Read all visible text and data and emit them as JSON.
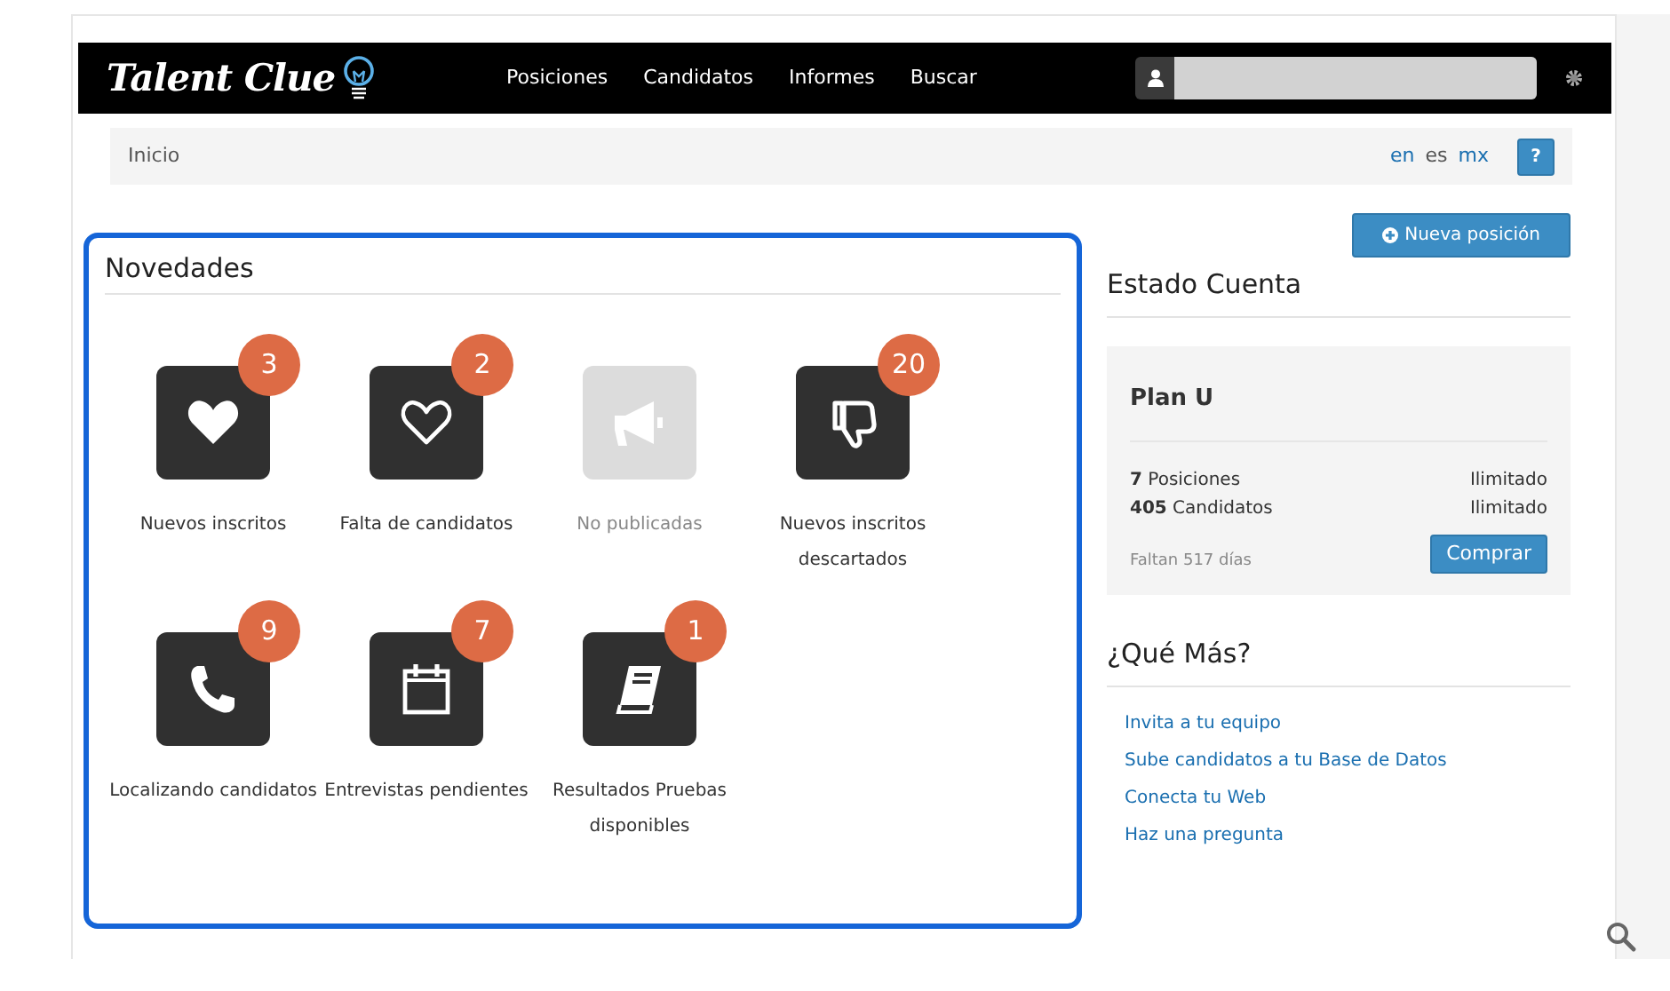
{
  "navbar": {
    "logo": "Talent Clue",
    "links": [
      "Posiciones",
      "Candidatos",
      "Informes",
      "Buscar"
    ]
  },
  "breadcrumb": {
    "current": "Inicio",
    "languages": [
      "en",
      "es",
      "mx"
    ],
    "help": "?"
  },
  "novedades": {
    "title": "Novedades",
    "tiles": [
      {
        "kind": "heart",
        "label": "Nuevos inscritos",
        "count": "3",
        "disabled": false
      },
      {
        "kind": "heart-outline",
        "label": "Falta de candidatos",
        "count": "2",
        "disabled": false
      },
      {
        "kind": "megaphone",
        "label": "No publicadas",
        "disabled": true
      },
      {
        "kind": "thumbs-down",
        "label": "Nuevos inscritos descartados",
        "count": "20",
        "disabled": false
      },
      {
        "kind": "phone",
        "label": "Localizando candidatos",
        "count": "9",
        "disabled": false
      },
      {
        "kind": "calendar",
        "label": "Entrevistas pendientes",
        "count": "7",
        "disabled": false
      },
      {
        "kind": "book",
        "label": "Resultados Pruebas disponibles",
        "count": "1",
        "disabled": false
      }
    ]
  },
  "new_position_button": "Nueva posición",
  "estado_cuenta": {
    "title": "Estado Cuenta",
    "plan": "Plan U",
    "rows": [
      {
        "label": "**7** Posiciones",
        "value": "Ilimitado"
      },
      {
        "label": "**405** Candidatos",
        "value": "Ilimitado"
      }
    ],
    "remaining": "Faltan 517 días",
    "buy_button": "Comprar"
  },
  "que_mas": {
    "title": "¿Qué Más?",
    "links": [
      "Invita a tu equipo",
      "Sube candidatos a tu Base de Datos",
      "Conecta tu Web",
      "Haz una pregunta"
    ]
  }
}
